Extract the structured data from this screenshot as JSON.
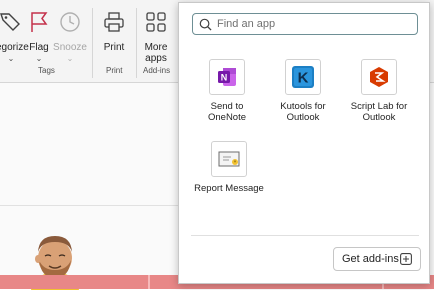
{
  "ribbon": {
    "categorize_label": "egorize",
    "flag_label": "Flag",
    "snooze_label": "Snooze",
    "tags_group": "Tags",
    "print_label": "Print",
    "print_group": "Print",
    "more_apps_label_line1": "More",
    "more_apps_label_line2": "apps",
    "addins_group": "Add-ins"
  },
  "search": {
    "placeholder": "Find an app"
  },
  "apps": [
    {
      "name_line1": "Send to",
      "name_line2": "OneNote",
      "icon": "onenote-icon"
    },
    {
      "name_line1": "Kutools for",
      "name_line2": "Outlook",
      "icon": "kutools-icon"
    },
    {
      "name_line1": "Script Lab for",
      "name_line2": "Outlook",
      "icon": "script-lab-icon"
    },
    {
      "name_line1": "Report Message",
      "name_line2": "",
      "icon": "report-message-icon"
    }
  ],
  "footer": {
    "get_addins_label": "Get add-ins"
  },
  "colors": {
    "onenote": "#7719aa",
    "kutools": "#1c7fc4",
    "script_lab": "#d83b01",
    "flag": "#c4314b",
    "banner": "#e88787"
  }
}
